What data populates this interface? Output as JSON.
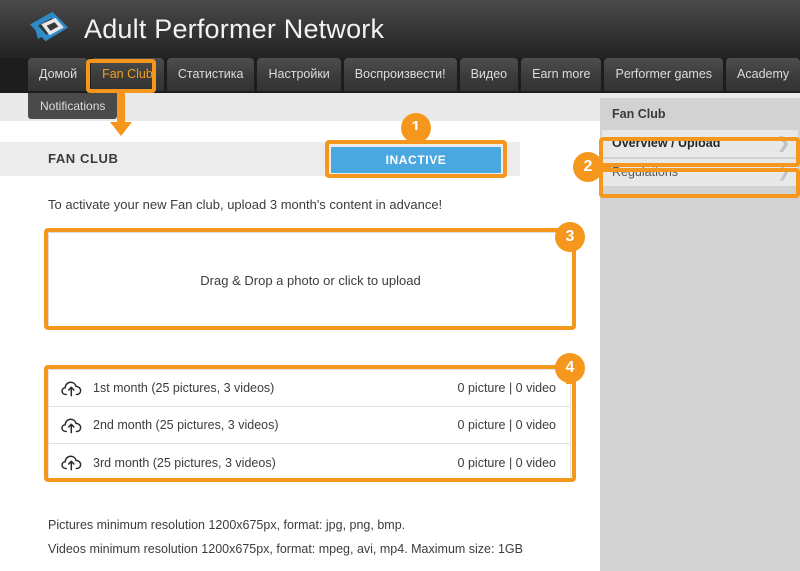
{
  "header": {
    "brand_title": "Adult Performer Network",
    "logo_icon": "network-logo-icon"
  },
  "nav": {
    "tabs": [
      {
        "label": "Домой",
        "active": false
      },
      {
        "label": "Fan Club",
        "active": true
      },
      {
        "label": "Статистика",
        "active": false
      },
      {
        "label": "Настройки",
        "active": false
      },
      {
        "label": "Воспроизвести!",
        "active": false
      },
      {
        "label": "Видео",
        "active": false
      },
      {
        "label": "Earn more",
        "active": false
      },
      {
        "label": "Performer games",
        "active": false
      },
      {
        "label": "Academy",
        "active": false
      }
    ]
  },
  "subnav": {
    "item_label": "Notifications"
  },
  "main": {
    "page_title": "FAN CLUB",
    "status_button": "INACTIVE",
    "intro_text": "To activate your new Fan club, upload 3 month's content in advance!",
    "dropzone_text": "Drag & Drop a photo or click to upload",
    "months": [
      {
        "icon": "cloud-upload-icon",
        "label": "1st month (25 pictures, 3 videos)",
        "count": "0 picture | 0 video"
      },
      {
        "icon": "cloud-upload-icon",
        "label": "2nd month (25 pictures, 3 videos)",
        "count": "0 picture | 0 video"
      },
      {
        "icon": "cloud-upload-icon",
        "label": "3rd month (25 pictures, 3 videos)",
        "count": "0 picture | 0 video"
      }
    ],
    "footnotes": [
      "Pictures minimum resolution 1200x675px, format: jpg, png, bmp.",
      "Videos minimum resolution 1200x675px, format: mpeg, avi, mp4. Maximum size: 1GB"
    ]
  },
  "sidebar": {
    "title": "Fan Club",
    "items": [
      {
        "label": "Overview / Upload",
        "active": true,
        "chevron": "chevron-right-icon"
      },
      {
        "label": "Regulations",
        "active": false,
        "chevron": "chevron-right-icon"
      }
    ]
  },
  "annotations": {
    "badges": [
      "1",
      "2",
      "3",
      "4"
    ],
    "accent_color": "#f5971d",
    "status_color": "#4aa7df"
  }
}
